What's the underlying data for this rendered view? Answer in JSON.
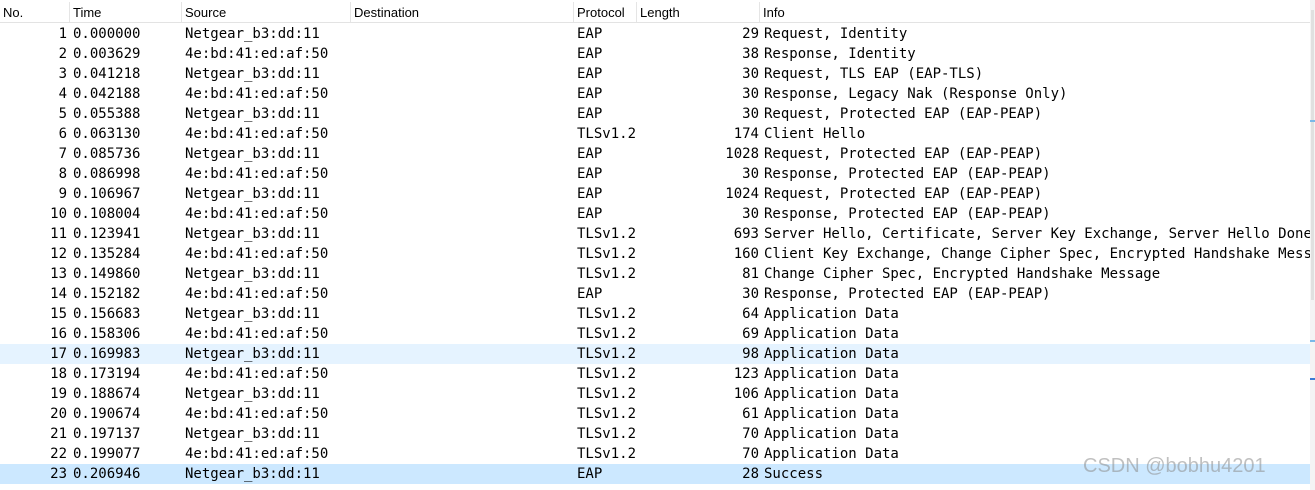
{
  "columns": {
    "no": "No.",
    "time": "Time",
    "source": "Source",
    "destination": "Destination",
    "protocol": "Protocol",
    "length": "Length",
    "info": "Info"
  },
  "packets": [
    {
      "no": "1",
      "time": "0.000000",
      "source": "Netgear_b3:dd:11",
      "destination": "",
      "protocol": "EAP",
      "length": "29",
      "info": "Request, Identity"
    },
    {
      "no": "2",
      "time": "0.003629",
      "source": "4e:bd:41:ed:af:50",
      "destination": "",
      "protocol": "EAP",
      "length": "38",
      "info": "Response, Identity"
    },
    {
      "no": "3",
      "time": "0.041218",
      "source": "Netgear_b3:dd:11",
      "destination": "",
      "protocol": "EAP",
      "length": "30",
      "info": "Request, TLS EAP (EAP-TLS)"
    },
    {
      "no": "4",
      "time": "0.042188",
      "source": "4e:bd:41:ed:af:50",
      "destination": "",
      "protocol": "EAP",
      "length": "30",
      "info": "Response, Legacy Nak (Response Only)"
    },
    {
      "no": "5",
      "time": "0.055388",
      "source": "Netgear_b3:dd:11",
      "destination": "",
      "protocol": "EAP",
      "length": "30",
      "info": "Request, Protected EAP (EAP-PEAP)"
    },
    {
      "no": "6",
      "time": "0.063130",
      "source": "4e:bd:41:ed:af:50",
      "destination": "",
      "protocol": "TLSv1.2",
      "length": "174",
      "info": "Client Hello"
    },
    {
      "no": "7",
      "time": "0.085736",
      "source": "Netgear_b3:dd:11",
      "destination": "",
      "protocol": "EAP",
      "length": "1028",
      "info": "Request, Protected EAP (EAP-PEAP)"
    },
    {
      "no": "8",
      "time": "0.086998",
      "source": "4e:bd:41:ed:af:50",
      "destination": "",
      "protocol": "EAP",
      "length": "30",
      "info": "Response, Protected EAP (EAP-PEAP)"
    },
    {
      "no": "9",
      "time": "0.106967",
      "source": "Netgear_b3:dd:11",
      "destination": "",
      "protocol": "EAP",
      "length": "1024",
      "info": "Request, Protected EAP (EAP-PEAP)"
    },
    {
      "no": "10",
      "time": "0.108004",
      "source": "4e:bd:41:ed:af:50",
      "destination": "",
      "protocol": "EAP",
      "length": "30",
      "info": "Response, Protected EAP (EAP-PEAP)"
    },
    {
      "no": "11",
      "time": "0.123941",
      "source": "Netgear_b3:dd:11",
      "destination": "",
      "protocol": "TLSv1.2",
      "length": "693",
      "info": "Server Hello, Certificate, Server Key Exchange, Server Hello Done"
    },
    {
      "no": "12",
      "time": "0.135284",
      "source": "4e:bd:41:ed:af:50",
      "destination": "",
      "protocol": "TLSv1.2",
      "length": "160",
      "info": "Client Key Exchange, Change Cipher Spec, Encrypted Handshake Message"
    },
    {
      "no": "13",
      "time": "0.149860",
      "source": "Netgear_b3:dd:11",
      "destination": "",
      "protocol": "TLSv1.2",
      "length": "81",
      "info": "Change Cipher Spec, Encrypted Handshake Message"
    },
    {
      "no": "14",
      "time": "0.152182",
      "source": "4e:bd:41:ed:af:50",
      "destination": "",
      "protocol": "EAP",
      "length": "30",
      "info": "Response, Protected EAP (EAP-PEAP)"
    },
    {
      "no": "15",
      "time": "0.156683",
      "source": "Netgear_b3:dd:11",
      "destination": "",
      "protocol": "TLSv1.2",
      "length": "64",
      "info": "Application Data"
    },
    {
      "no": "16",
      "time": "0.158306",
      "source": "4e:bd:41:ed:af:50",
      "destination": "",
      "protocol": "TLSv1.2",
      "length": "69",
      "info": "Application Data"
    },
    {
      "no": "17",
      "time": "0.169983",
      "source": "Netgear_b3:dd:11",
      "destination": "",
      "protocol": "TLSv1.2",
      "length": "98",
      "info": "Application Data",
      "state": "hover"
    },
    {
      "no": "18",
      "time": "0.173194",
      "source": "4e:bd:41:ed:af:50",
      "destination": "",
      "protocol": "TLSv1.2",
      "length": "123",
      "info": "Application Data"
    },
    {
      "no": "19",
      "time": "0.188674",
      "source": "Netgear_b3:dd:11",
      "destination": "",
      "protocol": "TLSv1.2",
      "length": "106",
      "info": "Application Data"
    },
    {
      "no": "20",
      "time": "0.190674",
      "source": "4e:bd:41:ed:af:50",
      "destination": "",
      "protocol": "TLSv1.2",
      "length": "61",
      "info": "Application Data"
    },
    {
      "no": "21",
      "time": "0.197137",
      "source": "Netgear_b3:dd:11",
      "destination": "",
      "protocol": "TLSv1.2",
      "length": "70",
      "info": "Application Data"
    },
    {
      "no": "22",
      "time": "0.199077",
      "source": "4e:bd:41:ed:af:50",
      "destination": "",
      "protocol": "TLSv1.2",
      "length": "70",
      "info": "Application Data"
    },
    {
      "no": "23",
      "time": "0.206946",
      "source": "Netgear_b3:dd:11",
      "destination": "",
      "protocol": "EAP",
      "length": "28",
      "info": "Success",
      "state": "selected"
    }
  ],
  "colors": {
    "hover_row": "#e5f3ff",
    "selected_row": "#cce8ff"
  },
  "watermark": "CSDN @bobhu4201"
}
